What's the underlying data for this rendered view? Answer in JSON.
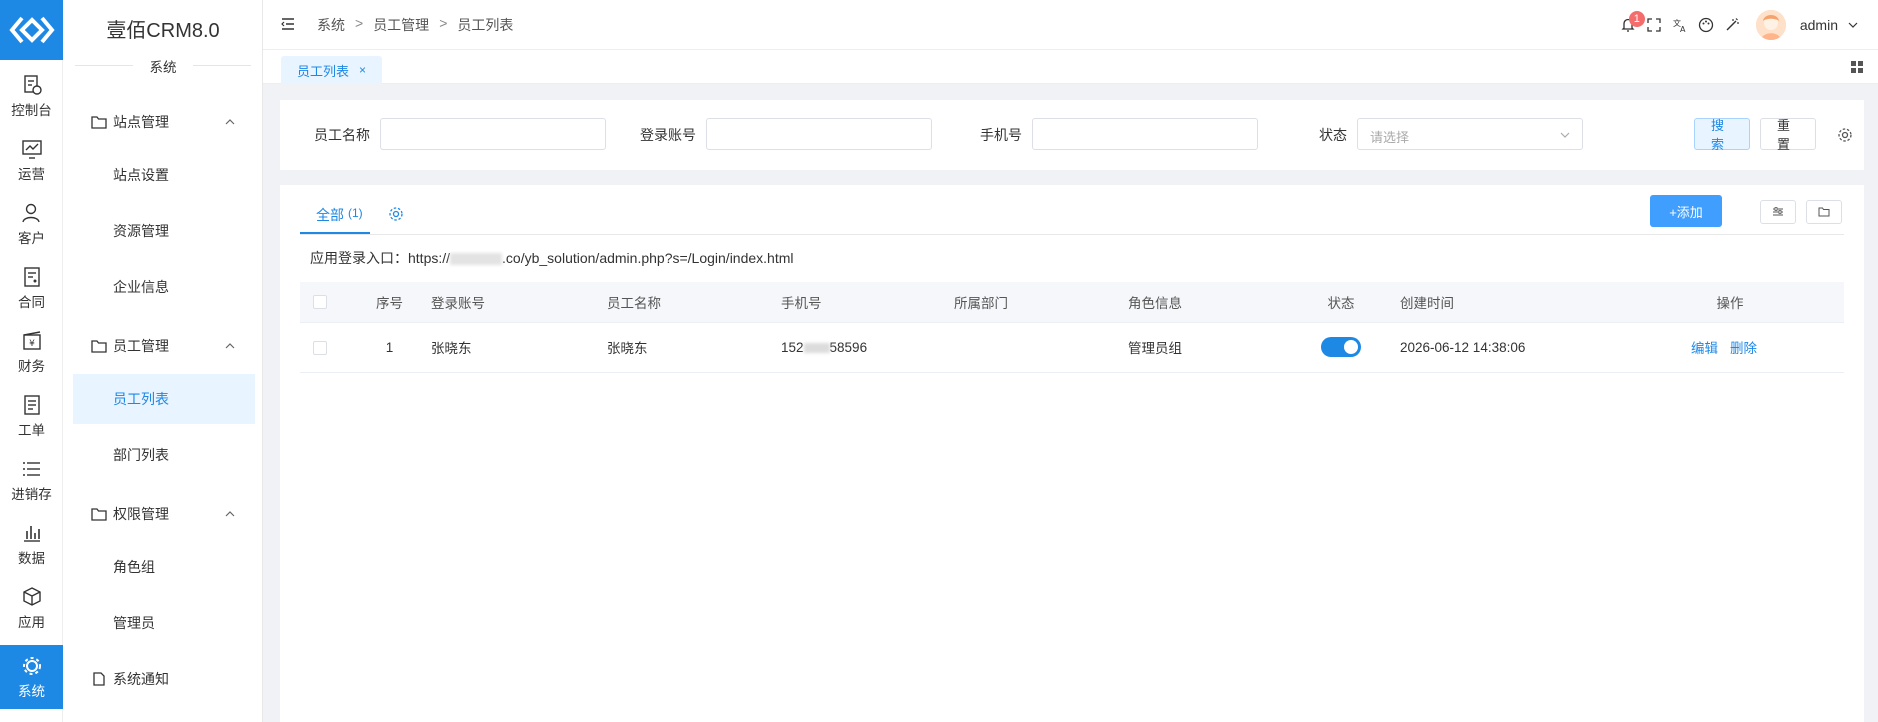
{
  "app": {
    "title": "壹佰CRM8.0",
    "subtitle": "系统"
  },
  "rail": [
    {
      "label": "控制台",
      "icon": "dashboard-icon"
    },
    {
      "label": "运营",
      "icon": "operations-icon"
    },
    {
      "label": "客户",
      "icon": "customer-icon"
    },
    {
      "label": "合同",
      "icon": "contract-icon"
    },
    {
      "label": "财务",
      "icon": "finance-icon"
    },
    {
      "label": "工单",
      "icon": "ticket-icon"
    },
    {
      "label": "进销存",
      "icon": "inventory-icon"
    },
    {
      "label": "数据",
      "icon": "data-icon"
    },
    {
      "label": "应用",
      "icon": "apps-icon"
    },
    {
      "label": "系统",
      "icon": "system-icon",
      "active": true
    }
  ],
  "sidebar": {
    "groups": [
      {
        "label": "站点管理",
        "items": [
          "站点设置",
          "资源管理",
          "企业信息"
        ]
      },
      {
        "label": "员工管理",
        "items": [
          "员工列表",
          "部门列表"
        ]
      },
      {
        "label": "权限管理",
        "items": [
          "角色组",
          "管理员"
        ]
      }
    ],
    "notice": "系统通知",
    "active_item": "员工列表"
  },
  "header": {
    "breadcrumb": [
      "系统",
      "员工管理",
      "员工列表"
    ],
    "breadcrumb_sep": ">",
    "notification_count": "1",
    "user": "admin"
  },
  "tabs": [
    {
      "label": "员工列表",
      "close": "×"
    }
  ],
  "filter": {
    "name_label": "员工名称",
    "account_label": "登录账号",
    "phone_label": "手机号",
    "status_label": "状态",
    "status_placeholder": "请选择",
    "search_button": "搜索",
    "reset_button": "重置"
  },
  "main": {
    "tab_label": "全部",
    "tab_count": "(1)",
    "add_button": "+添加",
    "entry_prefix": "应用登录入口：https://",
    "entry_suffix": ".co/yb_solution/admin.php?s=/Login/index.html"
  },
  "table": {
    "columns": [
      "序号",
      "登录账号",
      "员工名称",
      "手机号",
      "所属部门",
      "角色信息",
      "状态",
      "创建时间",
      "操作"
    ],
    "rows": [
      {
        "index": "1",
        "account": "张晓东",
        "name": "张晓东",
        "phone_prefix": "152",
        "phone_suffix": "58596",
        "department": "",
        "role": "管理员组",
        "status_on": true,
        "created": "2026-06-12 14:38:06",
        "edit": "编辑",
        "delete": "删除"
      }
    ]
  },
  "colors": {
    "primary": "#1e88e5",
    "active_bg": "#e8f4ff",
    "badge": "#f56c6c"
  }
}
